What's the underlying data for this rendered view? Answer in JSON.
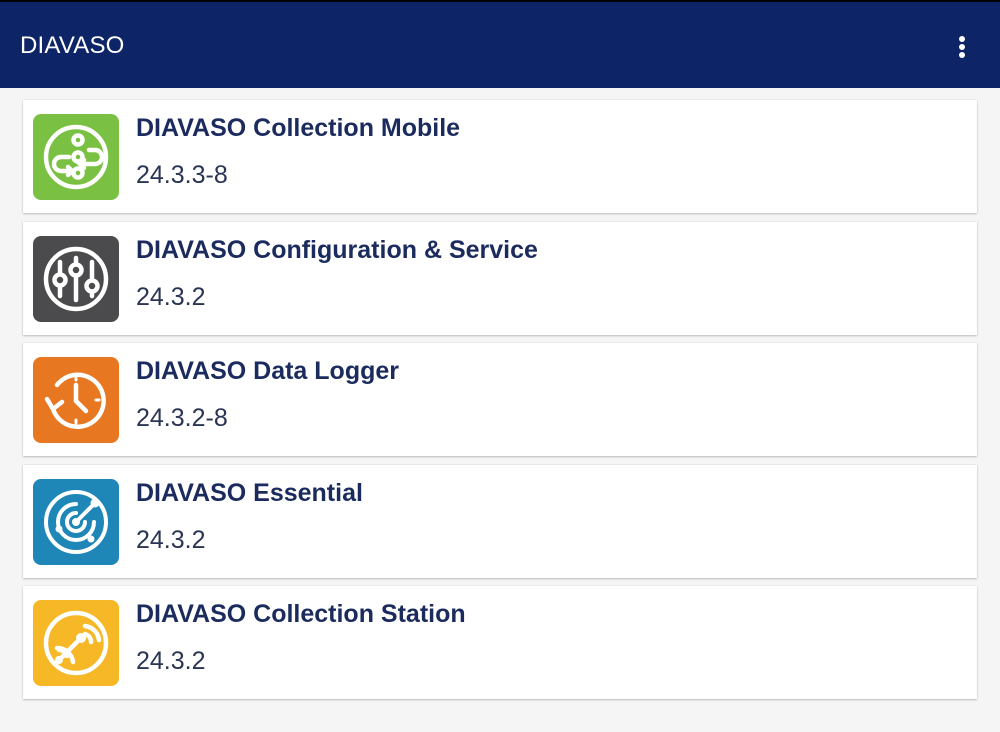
{
  "appbar": {
    "title": "DIAVASO",
    "menu_icon": "more-vert-icon",
    "background_color": "#0d2566"
  },
  "apps": [
    {
      "name": "DIAVASO Collection Mobile",
      "version": "24.3.3-8",
      "icon": "collection-mobile-icon",
      "icon_color": "#7ac143"
    },
    {
      "name": "DIAVASO Configuration & Service",
      "version": "24.3.2",
      "icon": "configuration-sliders-icon",
      "icon_color": "#4b4b4d"
    },
    {
      "name": "DIAVASO Data Logger",
      "version": "24.3.2-8",
      "icon": "data-logger-clock-icon",
      "icon_color": "#e87722"
    },
    {
      "name": "DIAVASO Essential",
      "version": "24.3.2",
      "icon": "essential-radar-icon",
      "icon_color": "#1f86b8"
    },
    {
      "name": "DIAVASO Collection Station",
      "version": "24.3.2",
      "icon": "collection-station-signal-icon",
      "icon_color": "#f6b826"
    }
  ]
}
